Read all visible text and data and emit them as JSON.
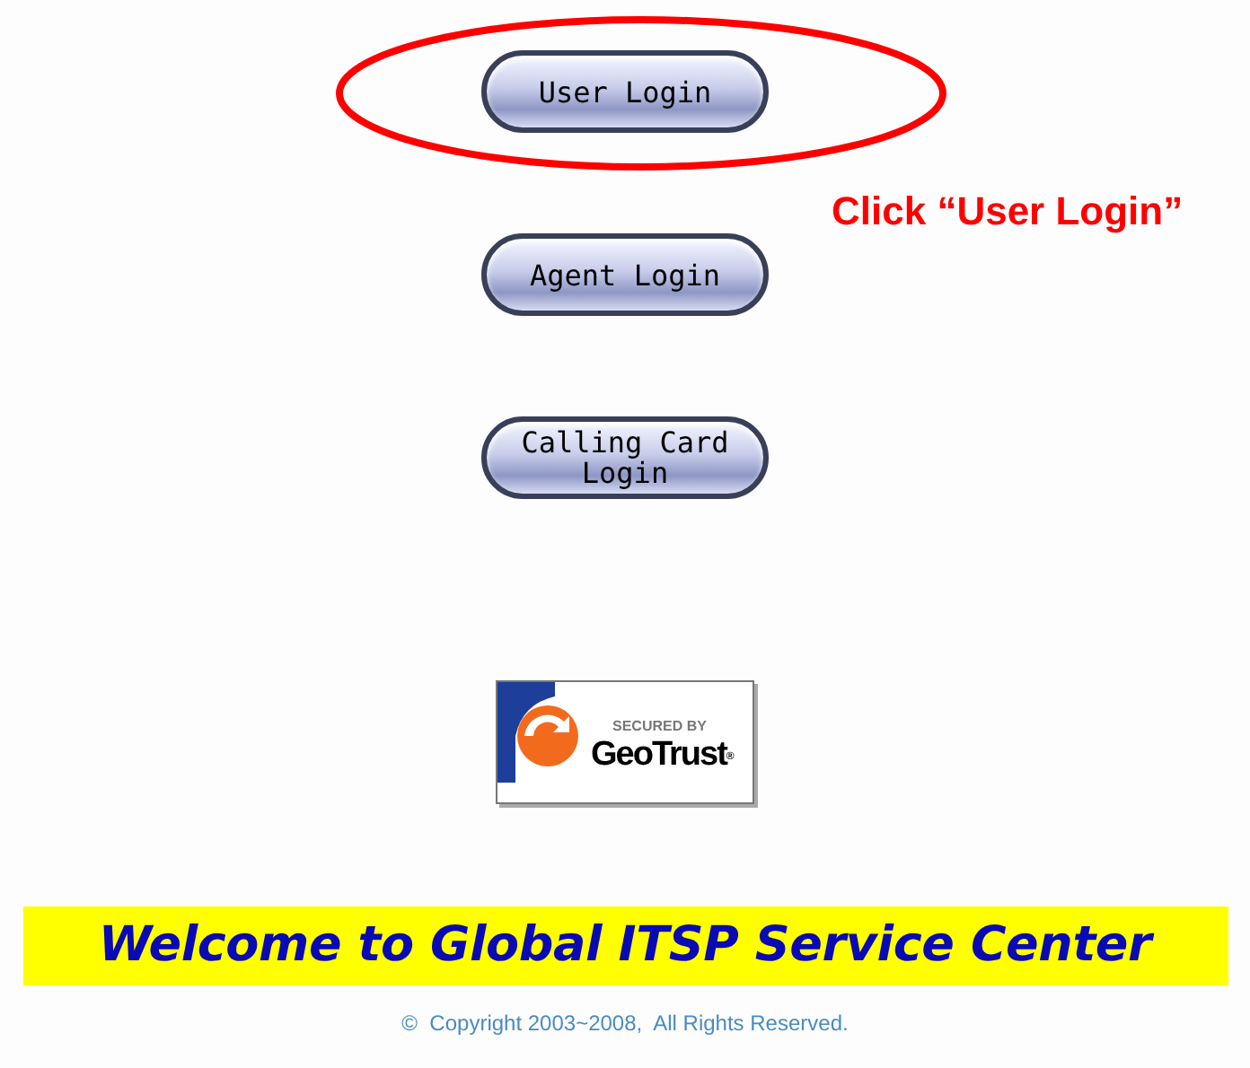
{
  "login_buttons": [
    {
      "label": "User Login"
    },
    {
      "label": "Agent Login"
    },
    {
      "label": "Calling Card Login"
    }
  ],
  "annotation": {
    "text": "Click “User Login”"
  },
  "security_badge": {
    "caption": "SECURED BY",
    "brand": "GeoTrust",
    "trademark": "®"
  },
  "banner": {
    "title": "Welcome to Global ITSP Service Center"
  },
  "footer": {
    "copyright": "©  Copyright 2003~2008,  All Rights Reserved."
  }
}
